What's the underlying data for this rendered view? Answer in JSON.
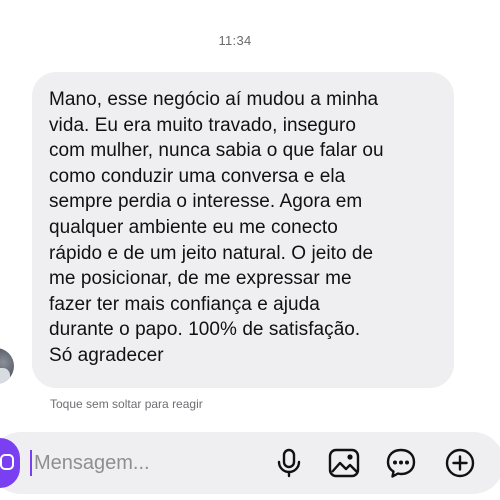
{
  "status": {
    "time": "11:34"
  },
  "message": {
    "text": "Mano, esse negócio aí mudou a minha\nvida. Eu era muito travado, inseguro\ncom mulher, nunca sabia o que falar ou\ncomo conduzir uma conversa e ela\nsempre perdia o interesse. Agora em\nqualquer ambiente eu me conecto\nrápido e de um jeito natural. O jeito de\nme posicionar, de me expressar me\nfazer ter mais confiança e ajuda\ndurante o papo. 100% de satisfação.\nSó agradecer",
    "reaction_hint": "Toque sem soltar para reagir"
  },
  "composer": {
    "placeholder": "Mensagem...",
    "accent_color": "#7b3ff2",
    "icons": [
      "camera-icon",
      "microphone-icon",
      "gallery-icon",
      "sticker-icon",
      "plus-icon"
    ]
  }
}
